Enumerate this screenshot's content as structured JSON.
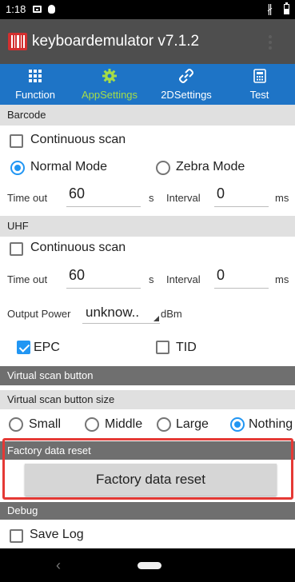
{
  "status_bar": {
    "time": "1:18"
  },
  "app_bar": {
    "title": "keyboardemulator v7.1.2"
  },
  "tabs": [
    {
      "label": "Function",
      "icon": "grid-icon"
    },
    {
      "label": "AppSettings",
      "icon": "gear-icon",
      "active": true
    },
    {
      "label": "2DSettings",
      "icon": "link-icon"
    },
    {
      "label": "Test",
      "icon": "calculator-icon"
    }
  ],
  "barcode": {
    "header": "Barcode",
    "continuous_scan": "Continuous scan",
    "normal_mode": "Normal Mode",
    "zebra_mode": "Zebra Mode",
    "timeout_label": "Time out",
    "timeout_value": "60",
    "timeout_unit": "s",
    "interval_label": "Interval",
    "interval_value": "0",
    "interval_unit": "ms"
  },
  "uhf": {
    "header": "UHF",
    "continuous_scan": "Continuous scan",
    "timeout_label": "Time out",
    "timeout_value": "60",
    "timeout_unit": "s",
    "interval_label": "Interval",
    "interval_value": "0",
    "interval_unit": "ms",
    "output_power_label": "Output Power",
    "output_power_value": "unknow..",
    "output_power_unit": "dBm",
    "epc": "EPC",
    "tid": "TID"
  },
  "virtual_scan": {
    "header": "Virtual scan button",
    "size_header": "Virtual scan button size",
    "options": [
      "Small",
      "Middle",
      "Large",
      "Nothing"
    ]
  },
  "factory_reset": {
    "header": "Factory data reset",
    "button_label": "Factory data reset"
  },
  "debug": {
    "header": "Debug",
    "save_log": "Save Log"
  },
  "colors": {
    "tab_bar": "#1e74c6",
    "active_tab": "#a5dd48",
    "app_bar": "#4e4e4e",
    "accent": "#2196f3",
    "highlight_frame": "#e53935"
  }
}
